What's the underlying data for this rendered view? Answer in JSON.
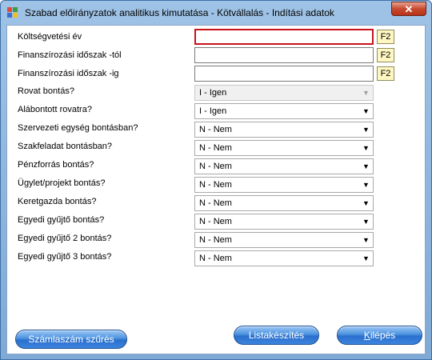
{
  "window": {
    "title": "Szabad előirányzatok analitikus kimutatása - Kötvállalás - Indítási adatok",
    "close_glyph": "✕",
    "icon": "app-grid-icon"
  },
  "fields": [
    {
      "label": "Költségvetési év",
      "type": "text",
      "value": "",
      "f2": "F2",
      "focused": true
    },
    {
      "label": "Finanszírozási időszak -tól",
      "type": "text",
      "value": "",
      "f2": "F2"
    },
    {
      "label": "Finanszírozási időszak -ig",
      "type": "text",
      "value": "",
      "f2": "F2"
    }
  ],
  "combos": [
    {
      "label": "Rovat bontás?",
      "value": "I - Igen",
      "disabled": true
    },
    {
      "label": "Alábontott rovatra?",
      "value": "I - Igen"
    },
    {
      "label": "Szervezeti egység bontásban?",
      "value": "N - Nem"
    },
    {
      "label": "Szakfeladat bontásban?",
      "value": "N - Nem"
    },
    {
      "label": "Pénzforrás bontás?",
      "value": "N - Nem"
    },
    {
      "label": "Ügylet/projekt bontás?",
      "value": "N - Nem"
    },
    {
      "label": "Keretgazda bontás?",
      "value": "N - Nem"
    },
    {
      "label": "Egyedi gyűjtő bontás?",
      "value": "N - Nem"
    },
    {
      "label": "Egyedi gyűjtő 2 bontás?",
      "value": "N - Nem"
    },
    {
      "label": "Egyedi gyűjtő 3 bontás?",
      "value": "N - Nem"
    }
  ],
  "buttons": {
    "szamlaszam": "Számlaszám szűrés",
    "listakeszites": "Listakészítés",
    "kilepes_first": "K",
    "kilepes_rest": "ilépés"
  },
  "colors": {
    "focus_border": "#c8141b",
    "f2_background": "#fff7c2",
    "button_blue": "#2a6fcc"
  }
}
